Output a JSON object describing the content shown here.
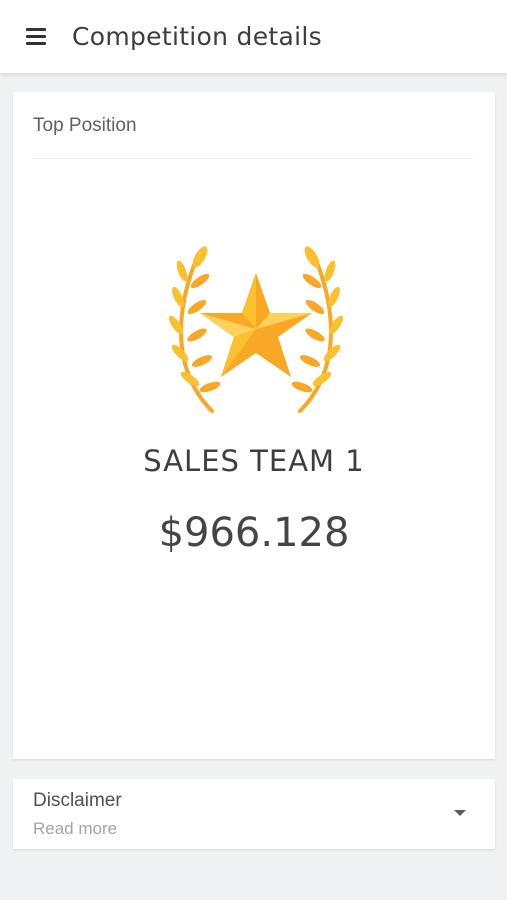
{
  "header": {
    "title": "Competition details",
    "menu_icon": "hamburger-menu-icon"
  },
  "top_position": {
    "title": "Top Position",
    "icon": "star-laurel-icon",
    "team_name": "SALES TEAM 1",
    "amount": "$966.128"
  },
  "disclaimer": {
    "title": "Disclaimer",
    "subtitle": "Read more",
    "icon": "caret-down-icon"
  },
  "colors": {
    "background": "#eff1f3",
    "card": "#ffffff",
    "gold_light": "#fbc02d",
    "gold_dark": "#f9a825",
    "text_primary": "#3e3e3e",
    "text_secondary": "#a3a3a3"
  }
}
